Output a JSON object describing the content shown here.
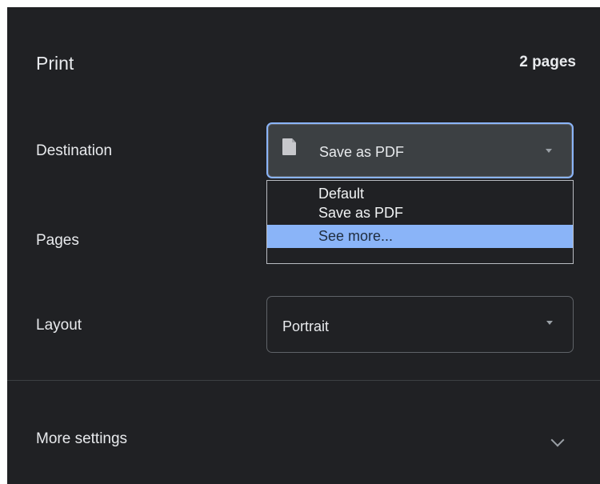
{
  "header": {
    "title": "Print",
    "page_count": "2 pages"
  },
  "settings": {
    "destination": {
      "label": "Destination",
      "selected": "Save as PDF",
      "icon": "file-icon",
      "options": [
        "Default",
        "Save as PDF",
        "See more..."
      ],
      "highlighted_option": "See more..."
    },
    "pages": {
      "label": "Pages"
    },
    "layout": {
      "label": "Layout",
      "selected": "Portrait"
    }
  },
  "footer": {
    "more_settings": "More settings",
    "expand_icon": "chevron-down-icon"
  },
  "colors": {
    "background": "#202124",
    "text": "#e8eaed",
    "accent": "#8ab4f8"
  }
}
